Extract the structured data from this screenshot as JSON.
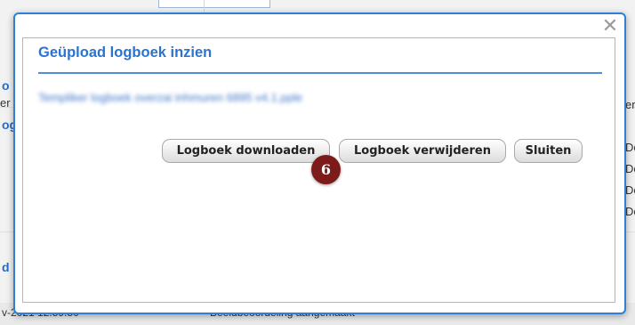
{
  "background": {
    "left_labels": [
      "o",
      "er",
      "og",
      "d"
    ],
    "right_labels": [
      "erz",
      "De",
      "De",
      "De",
      "De"
    ],
    "bottom_left_text": "v-2021 12:59:50",
    "bottom_right_text": "Beeldbeoordeling aangemaakt"
  },
  "dialog": {
    "title": "Geüpload logboek inzien",
    "blurred_text": "Templiker logboek overzai inhmuren 6895 v4.1.pple",
    "buttons": {
      "download": "Logboek downloaden",
      "delete": "Logboek verwijderen",
      "close": "Sluiten"
    },
    "close_icon": "✕",
    "step_badge": "6"
  },
  "colors": {
    "accent": "#2a73cf",
    "modal_border": "#2f7fd6",
    "badge": "#7d1a1a"
  }
}
